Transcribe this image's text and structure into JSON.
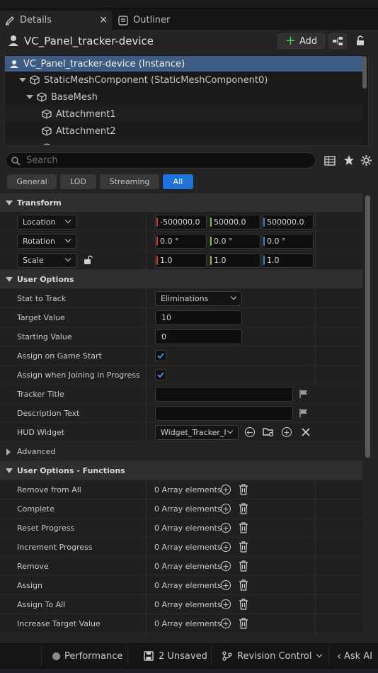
{
  "tabs": [
    {
      "label": "Details",
      "icon": "pencil-icon",
      "active": true,
      "close": "×"
    },
    {
      "label": "Outliner",
      "icon": "outliner-icon",
      "active": false
    }
  ],
  "actor": {
    "name": "VC_Panel_tracker-device",
    "add_label": "Add"
  },
  "tree": [
    {
      "label": "VC_Panel_tracker-device (Instance)",
      "level": 0,
      "selected": true
    },
    {
      "label": "StaticMeshComponent (StaticMeshComponent0)",
      "level": 1
    },
    {
      "label": "BaseMesh",
      "level": 2
    },
    {
      "label": "Attachment1",
      "level": 3
    },
    {
      "label": "Attachment2",
      "level": 3
    }
  ],
  "search": {
    "placeholder": "Search"
  },
  "filters": [
    "General",
    "LOD",
    "Streaming",
    "All"
  ],
  "active_filter": "All",
  "transform": {
    "title": "Transform",
    "location": {
      "label": "Location",
      "x": "-500000.0",
      "y": "50000.0",
      "z": "500000.0"
    },
    "rotation": {
      "label": "Rotation",
      "x": "0.0 °",
      "y": "0.0 °",
      "z": "0.0 °"
    },
    "scale": {
      "label": "Scale",
      "x": "1.0",
      "y": "1.0",
      "z": "1.0"
    }
  },
  "user_options": {
    "title": "User Options",
    "stat_to_track": {
      "label": "Stat to Track",
      "value": "Eliminations"
    },
    "target_value": {
      "label": "Target Value",
      "value": "10"
    },
    "starting_value": {
      "label": "Starting Value",
      "value": "0"
    },
    "assign_on_game_start": {
      "label": "Assign on Game Start",
      "checked": true
    },
    "assign_when_joining": {
      "label": "Assign when Joining in Progress",
      "checked": true
    },
    "tracker_title": {
      "label": "Tracker Title",
      "value": ""
    },
    "description_text": {
      "label": "Description Text",
      "value": ""
    },
    "hud_widget": {
      "label": "HUD Widget",
      "value": "Widget_Tracker_I"
    },
    "advanced": "Advanced"
  },
  "functions": {
    "title": "User Options - Functions",
    "rows": [
      {
        "label": "Remove from All",
        "value": "0 Array elements"
      },
      {
        "label": "Complete",
        "value": "0 Array elements"
      },
      {
        "label": "Reset Progress",
        "value": "0 Array elements"
      },
      {
        "label": "Increment Progress",
        "value": "0 Array elements"
      },
      {
        "label": "Remove",
        "value": "0 Array elements"
      },
      {
        "label": "Assign",
        "value": "0 Array elements"
      },
      {
        "label": "Assign To All",
        "value": "0 Array elements"
      },
      {
        "label": "Increase Target Value",
        "value": "0 Array elements"
      }
    ]
  },
  "statusbar": {
    "performance": "Performance",
    "unsaved": "2 Unsaved",
    "revision": "Revision Control",
    "ask_ai": "Ask AI"
  },
  "colors": {
    "x_axis": "#d43a3a",
    "y_axis": "#7fc241",
    "z_axis": "#3a82e0",
    "accent": "#1f73d8",
    "selection": "#3c5c84"
  }
}
